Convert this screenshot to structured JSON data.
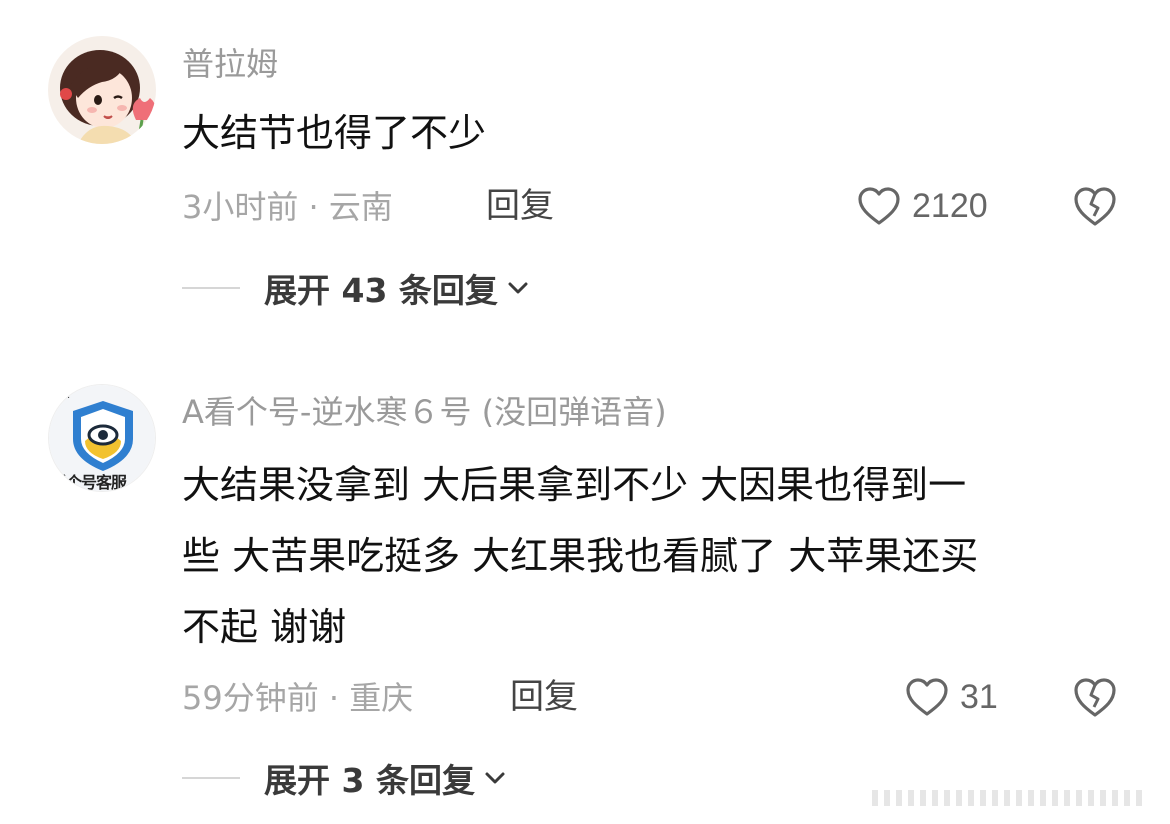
{
  "comments": [
    {
      "username": "普拉姆",
      "content": "大结节也得了不少",
      "time_location": "3小时前 · 云南",
      "reply_label": "回复",
      "likes": "2120",
      "expand_label": "展开 43 条回复",
      "avatar_icon": "girl-avatar-icon"
    },
    {
      "username": "A看个号-逆水寒６号 (没回弹语音)",
      "content_lines": [
        "大结果没拿到 大后果拿到不少 大因果也得到一",
        "些 大苦果吃挺多 大红果我也看腻了 大苹果还买",
        "不起 谢谢"
      ],
      "time_location": "59分钟前 · 重庆",
      "reply_label": "回复",
      "likes": "31",
      "expand_label": "展开 3 条回复",
      "avatar_icon": "shield-eye-avatar-icon",
      "avatar_text": "看个号客服"
    }
  ],
  "colors": {
    "text_primary": "#111111",
    "text_secondary": "#9a9a9a",
    "icon": "#666666",
    "shield_blue": "#2f7fd0",
    "shield_yellow": "#f2c230"
  }
}
